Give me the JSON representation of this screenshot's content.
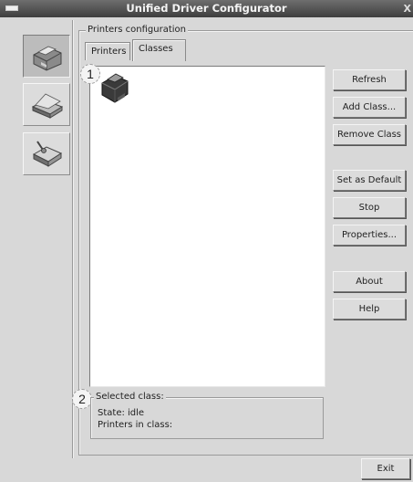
{
  "window": {
    "title": "Unified Driver Configurator"
  },
  "sidebar": {
    "tools": [
      {
        "name": "Printers",
        "icon": "printer-icon",
        "active": true
      },
      {
        "name": "Scanners",
        "icon": "scanner-icon",
        "active": false
      },
      {
        "name": "Ports",
        "icon": "port-icon",
        "active": false
      }
    ]
  },
  "group": {
    "title": "Printers configuration"
  },
  "tabs": [
    {
      "label": "Printers",
      "selected": false
    },
    {
      "label": "Classes",
      "selected": true
    }
  ],
  "callouts": [
    "1",
    "2"
  ],
  "class_list": {
    "items": [
      {
        "icon": "printer-class-icon"
      }
    ]
  },
  "info": {
    "title": "Selected class:",
    "state": "State: idle",
    "printers": "Printers in class:"
  },
  "buttons": {
    "refresh": "Refresh",
    "add_class": "Add Class...",
    "remove_class": "Remove Class",
    "set_default": "Set as Default",
    "stop": "Stop",
    "properties": "Properties...",
    "about": "About",
    "help": "Help",
    "exit": "Exit"
  },
  "colors": {
    "titlebar": "#4e4e4e",
    "window_bg": "#d8d8d8",
    "list_bg": "#ffffff"
  }
}
